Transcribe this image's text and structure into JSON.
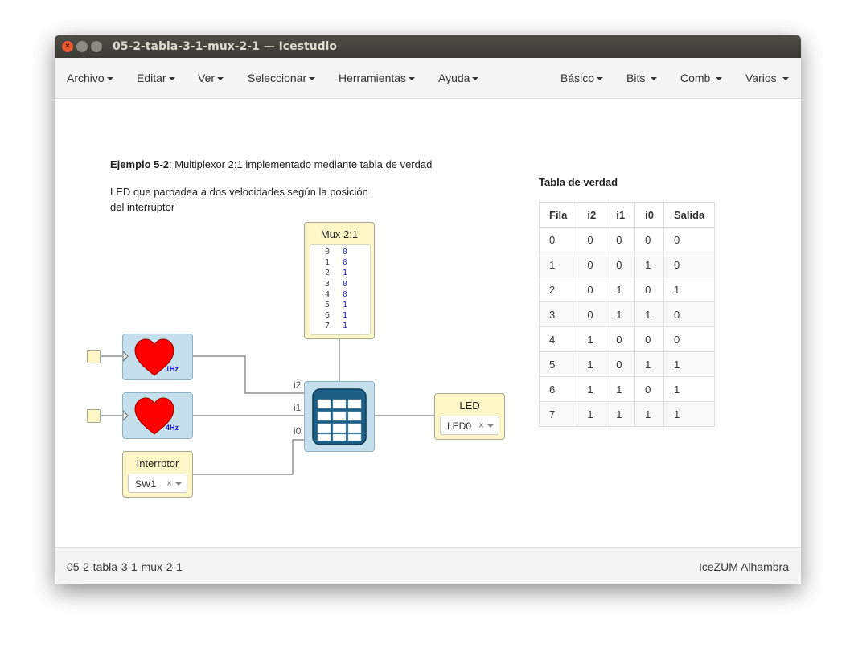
{
  "window": {
    "title": "05-2-tabla-3-1-mux-2-1 — Icestudio"
  },
  "menu": {
    "left": [
      "Archivo",
      "Editar",
      "Ver",
      "Seleccionar",
      "Herramientas",
      "Ayuda"
    ],
    "right": [
      "Básico",
      "Bits",
      "Comb",
      "Varios"
    ]
  },
  "canvas": {
    "title_bold": "Ejemplo 5-2",
    "title_rest": ": Multiplexor 2:1 implementado mediante tabla de verdad",
    "desc_line1": "LED que parpadea a dos velocidades según la posición",
    "desc_line2": "del interruptor",
    "mux": {
      "title": "Mux 2:1",
      "rows": [
        "0",
        "1",
        "2",
        "3",
        "4",
        "5",
        "6",
        "7"
      ],
      "values": [
        "0",
        "0",
        "1",
        "0",
        "0",
        "1",
        "1",
        "1"
      ]
    },
    "clock1": {
      "freq": "1Hz"
    },
    "clock2": {
      "freq": "4Hz"
    },
    "switch": {
      "title": "Interrptor",
      "value": "SW1"
    },
    "led": {
      "title": "LED",
      "value": "LED0"
    },
    "ports": {
      "i2": "i2",
      "i1": "i1",
      "i0": "i0"
    },
    "clear_symbol": "×"
  },
  "truth_table": {
    "title": "Tabla de verdad",
    "headers": [
      "Fila",
      "i2",
      "i1",
      "i0",
      "Salida"
    ],
    "rows": [
      [
        "0",
        "0",
        "0",
        "0",
        "0"
      ],
      [
        "1",
        "0",
        "0",
        "1",
        "0"
      ],
      [
        "2",
        "0",
        "1",
        "0",
        "1"
      ],
      [
        "3",
        "0",
        "1",
        "1",
        "0"
      ],
      [
        "4",
        "1",
        "0",
        "0",
        "0"
      ],
      [
        "5",
        "1",
        "0",
        "1",
        "1"
      ],
      [
        "6",
        "1",
        "1",
        "0",
        "1"
      ],
      [
        "7",
        "1",
        "1",
        "1",
        "1"
      ]
    ]
  },
  "footer": {
    "project": "05-2-tabla-3-1-mux-2-1",
    "board": "IceZUM Alhambra"
  },
  "colors": {
    "heart": "#ff0000",
    "freq_label": "#1a1acc",
    "block_yellow": "#fdf7c8",
    "block_blue": "#c5e0ec",
    "code_value": "#2020c0"
  }
}
